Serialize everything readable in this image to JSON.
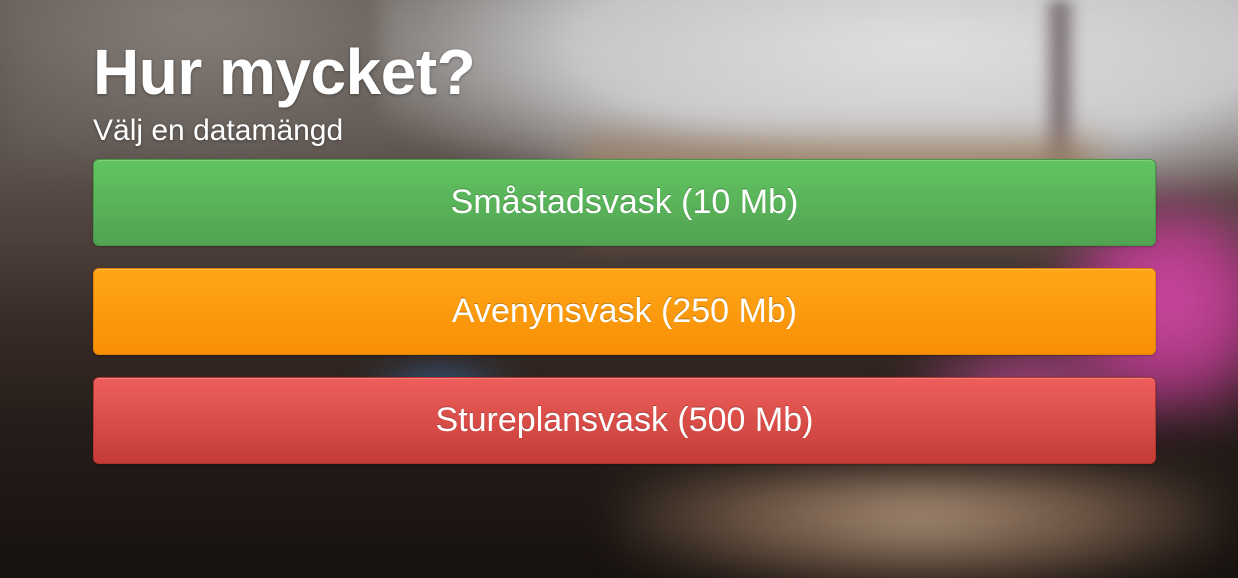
{
  "header": {
    "title": "Hur mycket?",
    "subtitle": "Välj en datamängd"
  },
  "options": [
    {
      "label": "Småstadsvask (10 Mb)",
      "color": "#5cb85c"
    },
    {
      "label": "Avenynsvask (250 Mb)",
      "color": "#f89406"
    },
    {
      "label": "Stureplansvask (500 Mb)",
      "color": "#d9534f"
    }
  ]
}
